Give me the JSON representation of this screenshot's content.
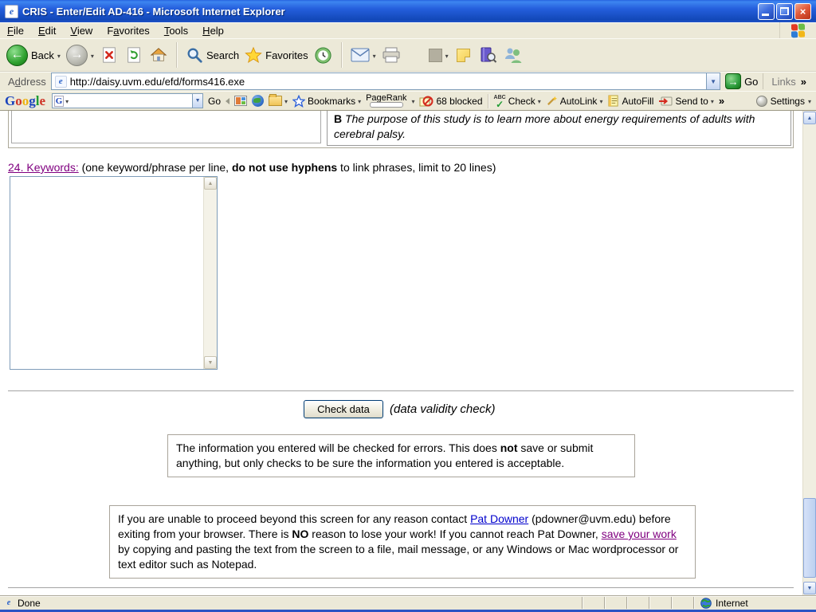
{
  "colors": {
    "titlebar_blue": "#245EDC",
    "chrome_beige": "#ECE9D8",
    "link_blue": "#0000CC",
    "link_visited": "#800080",
    "go_green": "#2E9E3E",
    "status_strip_blue": "#2A54C4"
  },
  "window": {
    "title": "CRIS - Enter/Edit AD-416 - Microsoft Internet Explorer"
  },
  "menu": {
    "items": [
      {
        "pre": "",
        "u": "F",
        "rest": "ile"
      },
      {
        "pre": "",
        "u": "E",
        "rest": "dit"
      },
      {
        "pre": "",
        "u": "V",
        "rest": "iew"
      },
      {
        "pre": "F",
        "u": "a",
        "rest": "vorites"
      },
      {
        "pre": "",
        "u": "T",
        "rest": "ools"
      },
      {
        "pre": "",
        "u": "H",
        "rest": "elp"
      }
    ]
  },
  "toolbar": {
    "back": "Back",
    "back_arrow": "←",
    "fwd_arrow": "→",
    "search": "Search",
    "favorites": "Favorites",
    "caret": "▾"
  },
  "address": {
    "label_pre": "A",
    "label_u": "d",
    "label_rest": "dress",
    "url": "http://daisy.uvm.edu/efd/forms416.exe",
    "go": "Go",
    "go_arrow": "→",
    "links": "Links",
    "chevron": "»",
    "drop": "▼"
  },
  "google": {
    "logo": [
      {
        "ch": "G"
      },
      {
        "ch": "o"
      },
      {
        "ch": "o"
      },
      {
        "ch": "g"
      },
      {
        "ch": "l"
      },
      {
        "ch": "e"
      }
    ],
    "g_icon": "G",
    "drop": "▼",
    "go": "Go",
    "bookmarks": "Bookmarks",
    "pagerank": "PageRank",
    "blocked": "68 blocked",
    "check_abc": "ABC",
    "check_tick": "✓",
    "check": "Check",
    "autolink": "AutoLink",
    "autofill": "AutoFill",
    "sendto": "Send to",
    "chevron": "»",
    "settings": "Settings",
    "star": "☆",
    "fav_star": "★",
    "caret": "▾"
  },
  "page": {
    "study": {
      "b": "B",
      "text": " The purpose of this study is to learn more about energy requirements of adults with cerebral palsy."
    },
    "keywords": {
      "label": "24. Keywords:",
      "pre": " (one keyword/phrase per line, ",
      "bold": "do not use hyphens",
      "post": " to link phrases, limit to 20 lines)",
      "value": ""
    },
    "check": {
      "button": "Check data",
      "hint": "(data validity check)"
    },
    "box1": {
      "pre": "The information you entered will be checked for errors. This does ",
      "bold": "not",
      "post": " save or submit anything, but only checks to be sure the information you entered is acceptable."
    },
    "box2": {
      "p1": "If you are unable to proceed beyond this screen for any reason contact ",
      "link1": "Pat Downer",
      "p2": " (pdowner@uvm.edu) before exiting from your browser. There is ",
      "bold": "NO",
      "p3": " reason to lose your work! If you cannot reach Pat Downer, ",
      "link2": "save your work",
      "p4": " by copying and pasting the text from the screen to a file, mail message, or any Windows or Mac wordprocessor or text editor such as Notepad."
    },
    "scroll_up": "▲",
    "scroll_dn": "▼"
  },
  "status": {
    "text": "Done",
    "zone": "Internet"
  }
}
